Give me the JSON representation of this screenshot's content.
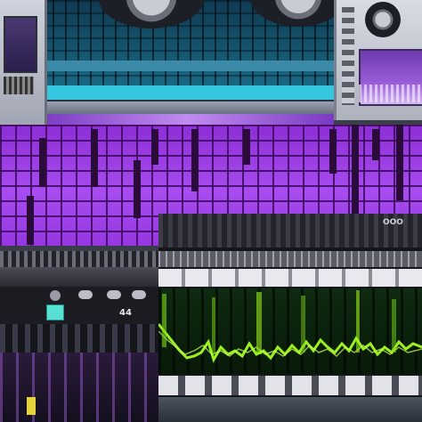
{
  "lcd_readout": "44",
  "editor_title": "OOO",
  "colors": {
    "purple_grid": "#a64cf0",
    "waveform": "#9cf01e",
    "cyan": "#35c7e0",
    "lcd": "#58e0d2"
  },
  "icons": [
    "speaker-icon",
    "knob-icon",
    "lcd-display-icon"
  ]
}
